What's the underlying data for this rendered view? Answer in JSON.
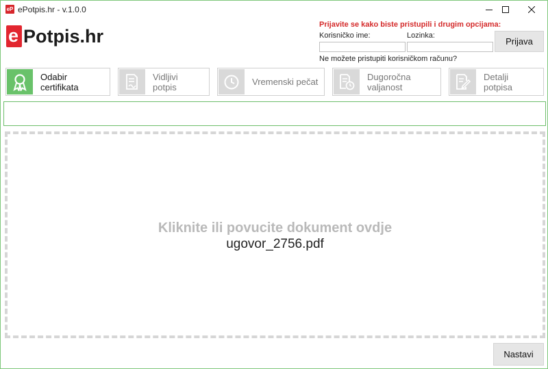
{
  "window": {
    "title": "ePotpis.hr - v.1.0.0",
    "icon_text": "eP",
    "controls": [
      "minimize-icon",
      "maximize-icon",
      "close-icon"
    ]
  },
  "logo": {
    "letter": "e",
    "rest": "Potpis.hr",
    "accent_color": "#e2262f"
  },
  "login": {
    "heading": "Prijavite se kako biste pristupili i drugim opcijama:",
    "username_label": "Korisničko ime:",
    "username_value": "",
    "password_label": "Lozinka:",
    "password_value": "",
    "submit_label": "Prijava",
    "forgot_link": "Ne možete pristupiti korisničkom računu?"
  },
  "steps": [
    {
      "label": "Odabir\ncertifikata",
      "icon": "certificate-icon",
      "active": true
    },
    {
      "label": "Vidljivi\npotpis",
      "icon": "signed-document-icon",
      "active": false
    },
    {
      "label": "Vremenski pečat",
      "icon": "clock-icon",
      "active": false
    },
    {
      "label": "Dugoročna\nvaljanost",
      "icon": "document-clock-icon",
      "active": false
    },
    {
      "label": "Detalji\npotpisa",
      "icon": "document-edit-icon",
      "active": false
    }
  ],
  "message_bar": {
    "text": ""
  },
  "dropzone": {
    "instruction": "Kliknite ili povucite dokument ovdje",
    "filename": "ugovor_2756.pdf"
  },
  "footer": {
    "next_label": "Nastavi"
  },
  "colors": {
    "accent_green": "#69c26a",
    "heading_red": "#d42a2a",
    "border_green": "#7ec77a"
  }
}
